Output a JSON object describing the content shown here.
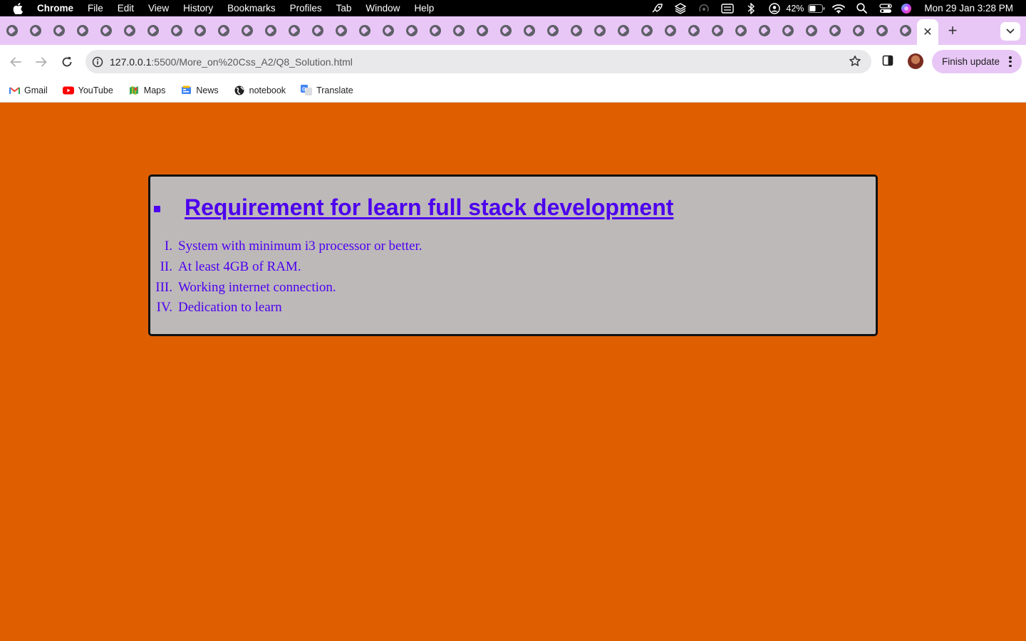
{
  "menubar": {
    "app_name": "Chrome",
    "items": [
      "File",
      "Edit",
      "View",
      "History",
      "Bookmarks",
      "Profiles",
      "Tab",
      "Window",
      "Help"
    ],
    "battery": "42%",
    "clock": "Mon 29 Jan  3:28 PM"
  },
  "tabs": {
    "close_glyph": "✕",
    "new_tab_glyph": "+"
  },
  "toolbar": {
    "url_host": "127.0.0.1",
    "url_path": ":5500/More_on%20Css_A2/Q8_Solution.html",
    "update_label": "Finish update"
  },
  "bookmarks": [
    {
      "label": "Gmail",
      "icon": "gmail-icon"
    },
    {
      "label": "YouTube",
      "icon": "youtube-icon"
    },
    {
      "label": "Maps",
      "icon": "maps-icon"
    },
    {
      "label": "News",
      "icon": "news-icon"
    },
    {
      "label": "notebook",
      "icon": "globe-icon"
    },
    {
      "label": "Translate",
      "icon": "translate-icon"
    }
  ],
  "content": {
    "heading": "Requirement for learn full stack development",
    "requirements": [
      {
        "numeral": "I.",
        "text": "System with minimum i3 processor or better."
      },
      {
        "numeral": "II.",
        "text": "At least 4GB of RAM."
      },
      {
        "numeral": "III.",
        "text": "Working internet connection."
      },
      {
        "numeral": "IV.",
        "text": "Dedication to learn"
      }
    ]
  },
  "colors": {
    "page_background": "#df5f00",
    "card_background": "#beb9b9",
    "text": "#4c00ee",
    "tab_strip": "#e8c7f6"
  }
}
